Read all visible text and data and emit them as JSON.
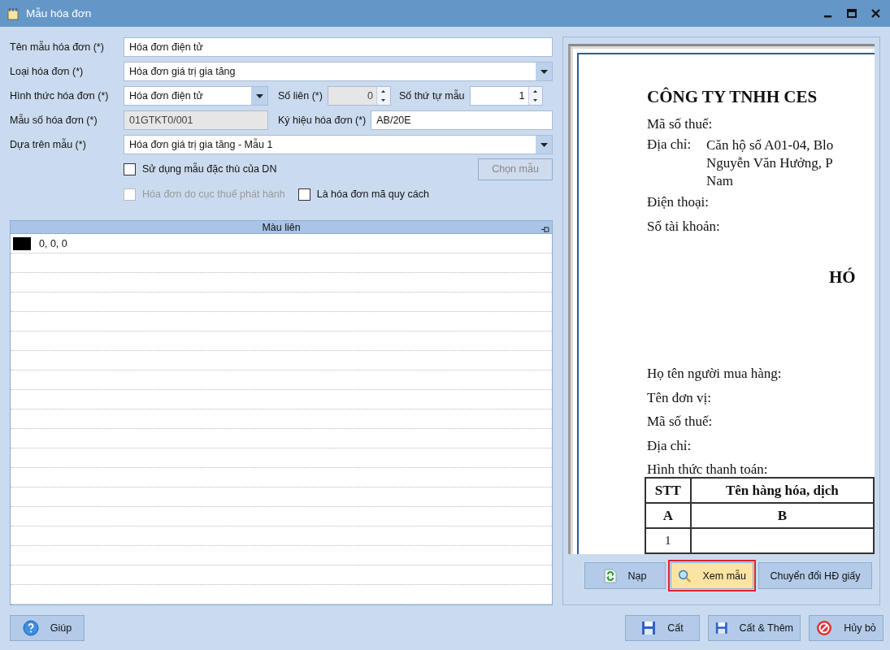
{
  "window": {
    "title": "Mẫu hóa đơn"
  },
  "form": {
    "template_name": {
      "label": "Tên mẫu hóa đơn (*)",
      "value": "Hóa đơn điện tử"
    },
    "invoice_type": {
      "label": "Loại hóa đơn (*)",
      "value": "Hóa đơn giá trị gia tăng"
    },
    "invoice_form": {
      "label": "Hình thức hóa đơn (*)",
      "value": "Hóa đơn điện tử"
    },
    "copies": {
      "label": "Số liên (*)",
      "value": "0",
      "disabled": true
    },
    "order": {
      "label": "Số thứ tự mẫu",
      "value": "1",
      "disabled": false
    },
    "invoice_code": {
      "label": "Mẫu số hóa đơn (*)",
      "value": "01GTKT0/001",
      "disabled": true
    },
    "symbol": {
      "label": "Ký hiệu hóa đơn (*)",
      "value": "AB/20E",
      "disabled": false
    },
    "base_template": {
      "label": "Dựa trên mẫu (*)",
      "value": "Hóa đơn giá trị gia tăng - Mẫu 1"
    },
    "checkboxes": [
      {
        "label": "Sử dụng mẫu đặc thù của DN",
        "checked": false,
        "disabled": false
      },
      {
        "label": "Hóa đơn do cục thuế phát hành",
        "checked": false,
        "disabled": true
      },
      {
        "label": "Là hóa đơn mã quy cách",
        "checked": false,
        "disabled": false
      }
    ],
    "choose_button": {
      "label": "Chọn mẫu",
      "disabled": true
    }
  },
  "color_grid": {
    "column": "Màu liên",
    "rows": [
      {
        "color": "#000000",
        "text": "0, 0, 0"
      }
    ]
  },
  "preview": {
    "company": "CÔNG TY TNHH CES",
    "tax_label": "Mã số thuế:",
    "address_label": "Địa chỉ:",
    "address_lines": [
      "Căn hộ số A01-04, Blo",
      "Nguyễn Văn Hưởng, P",
      "Nam"
    ],
    "phone_label": "Điện thoại:",
    "account_label": "Số tài khoản:",
    "title": "HÓ",
    "buyer_fields": [
      "Họ tên người mua hàng:",
      "Tên đơn vị:",
      "Mã số thuế:",
      "Địa chỉ:",
      "Hình thức thanh toán:"
    ],
    "table": {
      "columns": [
        "STT",
        "Tên hàng hóa, dịch"
      ],
      "letters": [
        "A",
        "B"
      ],
      "rows": [
        [
          "1"
        ]
      ]
    }
  },
  "preview_buttons": [
    {
      "label": "Nạp",
      "kind": "refresh",
      "selected": false
    },
    {
      "label": "Xem mẫu",
      "kind": "search",
      "selected": true
    },
    {
      "label": "Chuyển đổi HĐ giấy",
      "kind": "plain",
      "selected": false
    }
  ],
  "help_button": {
    "label": "Giúp"
  },
  "actions": [
    {
      "label": "Cất",
      "kind": "save"
    },
    {
      "label": "Cất & Thêm",
      "kind": "save"
    },
    {
      "label": "Hủy bỏ",
      "kind": "cancel"
    }
  ]
}
